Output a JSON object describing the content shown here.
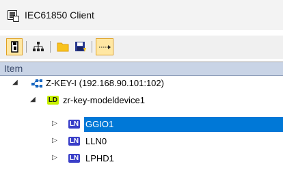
{
  "window": {
    "title": "IEC61850 Client",
    "icon": "app-window-icon"
  },
  "toolbar": {
    "buttons": [
      {
        "name": "open-icon",
        "active": true
      },
      {
        "name": "network-icon",
        "active": false
      },
      {
        "name": "folder-icon",
        "active": false
      },
      {
        "name": "save-icon",
        "active": false
      },
      {
        "name": "arrow-right-icon",
        "active": true
      }
    ]
  },
  "tree": {
    "column_header": "Item",
    "nodes": [
      {
        "level": 0,
        "expanded": true,
        "icon": "server-icon",
        "label": "Z-KEY-I (192.168.90.101:102)"
      },
      {
        "level": 1,
        "expanded": true,
        "badge": "LD",
        "label": "zr-key-modeldevice1"
      },
      {
        "level": 2,
        "expanded": false,
        "badge": "LN",
        "label": "GGIO1",
        "selected": true
      },
      {
        "level": 2,
        "expanded": false,
        "badge": "LN",
        "label": "LLN0"
      },
      {
        "level": 2,
        "expanded": false,
        "badge": "LN",
        "label": "LPHD1"
      }
    ]
  },
  "colors": {
    "selection": "#0078d7",
    "header_bg": "#c9d4e6",
    "ln_badge": "#3a3fc8",
    "ld_badge": "#c6f000",
    "toolbar_active": "#ffe7a3"
  }
}
